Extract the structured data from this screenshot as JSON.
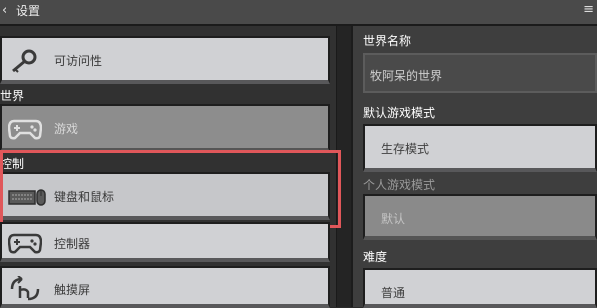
{
  "header": {
    "title": "设置",
    "back_icon": "chevron-left-icon",
    "right_glyph": "≡"
  },
  "left": {
    "accessibility_label": "可访问性",
    "world_section": "世界",
    "game_label": "游戏",
    "controls_section": "控制",
    "keyboard_label": "键盘和鼠标",
    "controller_label": "控制器",
    "touch_label": "触摸屏"
  },
  "right": {
    "world_name_label": "世界名称",
    "world_name_value": "牧阿呆的世界",
    "default_mode_label": "默认游戏模式",
    "default_mode_value": "生存模式",
    "personal_mode_label": "个人游戏模式",
    "personal_mode_value": "默认",
    "difficulty_label": "难度",
    "difficulty_value": "普通"
  },
  "colors": {
    "highlight": "#e0575a",
    "button_face": "#d0d1d4",
    "background": "#2b2b2b"
  }
}
